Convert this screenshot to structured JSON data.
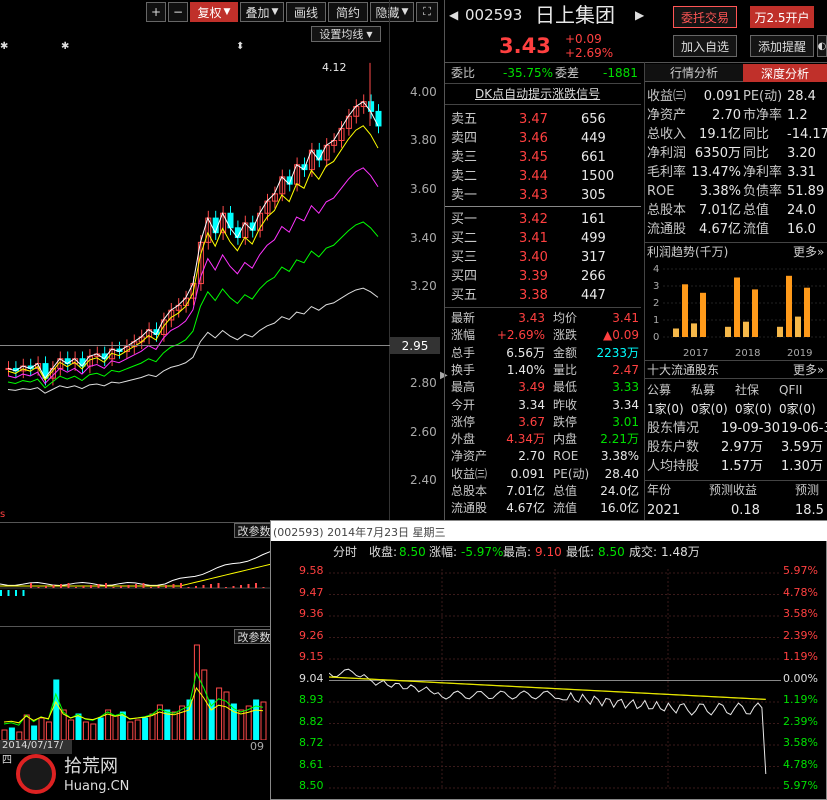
{
  "toolbar": {
    "plus": "+",
    "minus": "−",
    "restore": "复权",
    "overlay": "叠加",
    "draw_line": "画线",
    "simple": "简约",
    "hide": "隐藏"
  },
  "chart": {
    "ma_settings": "设置均线",
    "high_label": "4.12",
    "price_axis": [
      "4.00",
      "3.80",
      "3.60",
      "3.40",
      "3.20",
      "2.80",
      "2.60",
      "2.40"
    ],
    "cursor_price": "2.95",
    "indicator_settings_1": "改参数",
    "indicator_settings_2": "改参数",
    "date_label": "2014/07/17/四",
    "month_label": "09",
    "logo_text": "拾荒网",
    "logo_sub": "Huang.CN"
  },
  "stock": {
    "code": "002593",
    "name": "日上集团",
    "price": "3.43",
    "change": "+0.09",
    "change_pct": "+2.69%",
    "btn_trade": "委托交易",
    "btn_open": "万2.5开户",
    "btn_watch": "加入自选",
    "btn_alert": "添加提醒"
  },
  "orderbook": {
    "wb_label": "委比",
    "wb_value": "-35.75%",
    "wc_label": "委差",
    "wc_value": "-1881",
    "signal": "DK点自动提示涨跌信号",
    "sells": [
      {
        "label": "卖五",
        "price": "3.47",
        "vol": "656"
      },
      {
        "label": "卖四",
        "price": "3.46",
        "vol": "449"
      },
      {
        "label": "卖三",
        "price": "3.45",
        "vol": "661"
      },
      {
        "label": "卖二",
        "price": "3.44",
        "vol": "1500"
      },
      {
        "label": "卖一",
        "price": "3.43",
        "vol": "305"
      }
    ],
    "buys": [
      {
        "label": "买一",
        "price": "3.42",
        "vol": "161"
      },
      {
        "label": "买二",
        "price": "3.41",
        "vol": "499"
      },
      {
        "label": "买三",
        "price": "3.40",
        "vol": "317"
      },
      {
        "label": "买四",
        "price": "3.39",
        "vol": "266"
      },
      {
        "label": "买五",
        "price": "3.38",
        "vol": "447"
      }
    ]
  },
  "quote": [
    {
      "l1": "最新",
      "v1": "3.43",
      "c1": "red",
      "l2": "均价",
      "v2": "3.41",
      "c2": "red"
    },
    {
      "l1": "涨幅",
      "v1": "+2.69%",
      "c1": "red",
      "l2": "涨跌",
      "v2": "▲0.09",
      "c2": "red"
    },
    {
      "l1": "总手",
      "v1": "6.56万",
      "c1": "white",
      "l2": "金额",
      "v2": "2233万",
      "c2": "cyan"
    },
    {
      "l1": "换手",
      "v1": "1.40%",
      "c1": "white",
      "l2": "量比",
      "v2": "2.47",
      "c2": "red"
    },
    {
      "l1": "最高",
      "v1": "3.49",
      "c1": "red",
      "l2": "最低",
      "v2": "3.33",
      "c2": "green"
    },
    {
      "l1": "今开",
      "v1": "3.34",
      "c1": "white",
      "l2": "昨收",
      "v2": "3.34",
      "c2": "white"
    },
    {
      "l1": "涨停",
      "v1": "3.67",
      "c1": "red",
      "l2": "跌停",
      "v2": "3.01",
      "c2": "green"
    },
    {
      "l1": "外盘",
      "v1": "4.34万",
      "c1": "red",
      "l2": "内盘",
      "v2": "2.21万",
      "c2": "green"
    },
    {
      "l1": "净资产",
      "v1": "2.70",
      "c1": "white",
      "l2": "ROE",
      "v2": "3.38%",
      "c2": "white"
    },
    {
      "l1": "收益㈢",
      "v1": "0.091",
      "c1": "white",
      "l2": "PE(动)",
      "v2": "28.40",
      "c2": "white"
    },
    {
      "l1": "总股本",
      "v1": "7.01亿",
      "c1": "white",
      "l2": "总值",
      "v2": "24.0亿",
      "c2": "white"
    },
    {
      "l1": "流通股",
      "v1": "4.67亿",
      "c1": "white",
      "l2": "流值",
      "v2": "16.0亿",
      "c2": "white"
    }
  ],
  "fundamentals": {
    "tab1": "行情分析",
    "tab2": "深度分析",
    "rows": [
      {
        "l1": "收益㈢",
        "v1": "0.091",
        "l2": "PE(动)",
        "v2": "28.4"
      },
      {
        "l1": "净资产",
        "v1": "2.70",
        "l2": "市净率",
        "v2": "1.2"
      },
      {
        "l1": "总收入",
        "v1": "19.1亿",
        "l2": "同比",
        "v2": "-14.17"
      },
      {
        "l1": "净利润",
        "v1": "6350万",
        "l2": "同比",
        "v2": "3.20"
      },
      {
        "l1": "毛利率",
        "v1": "13.47%",
        "l2": "净利率",
        "v2": "3.31"
      },
      {
        "l1": "ROE",
        "v1": "3.38%",
        "l2": "负债率",
        "v2": "51.89"
      },
      {
        "l1": "总股本",
        "v1": "7.01亿",
        "l2": "总值",
        "v2": "24.0"
      },
      {
        "l1": "流通股",
        "v1": "4.67亿",
        "l2": "流值",
        "v2": "16.0"
      }
    ],
    "profit_title": "利润趋势(千万)",
    "more": "更多",
    "bar_y": [
      "4",
      "3",
      "2",
      "1",
      "0"
    ],
    "years": [
      "2017",
      "2018",
      "2019"
    ],
    "holders_title": "十大流通股东",
    "holders_more": "更多",
    "holder_types": [
      "公募",
      "私募",
      "社保",
      "QFII"
    ],
    "holder_vals": [
      "1家(0)",
      "0家(0)",
      "0家(0)",
      "0家(0)"
    ],
    "info": [
      {
        "l": "股东情况",
        "a": "19-09-30",
        "b": "19-06-3"
      },
      {
        "l": "股东户数",
        "a": "2.97万",
        "b": "3.59万"
      },
      {
        "l": "人均持股",
        "a": "1.57万",
        "b": "1.30万"
      }
    ],
    "forecast_hdr": [
      "年份",
      "预测收益",
      "预测"
    ],
    "forecast_row": [
      "2021",
      "0.18",
      "18.5"
    ]
  },
  "popup": {
    "title": "(002593) 2014年7月23日 星期三",
    "label_min": "分时",
    "close_label": "收盘:",
    "close_val": "8.50",
    "pct_label": "涨幅:",
    "pct_val": "-5.97%",
    "high_label": "最高:",
    "high_val": "9.10",
    "low_label": "最低:",
    "low_val": "8.50",
    "vol_label": "成交:",
    "vol_val": "1.48万",
    "left_axis": [
      "9.58",
      "9.47",
      "9.36",
      "9.26",
      "9.15",
      "9.04",
      "8.93",
      "8.82",
      "8.72",
      "8.61",
      "8.50"
    ],
    "right_axis": [
      "5.97%",
      "4.78%",
      "3.58%",
      "2.39%",
      "1.19%",
      "0.00%",
      "1.19%",
      "2.39%",
      "3.58%",
      "4.78%",
      "5.97%"
    ]
  }
}
